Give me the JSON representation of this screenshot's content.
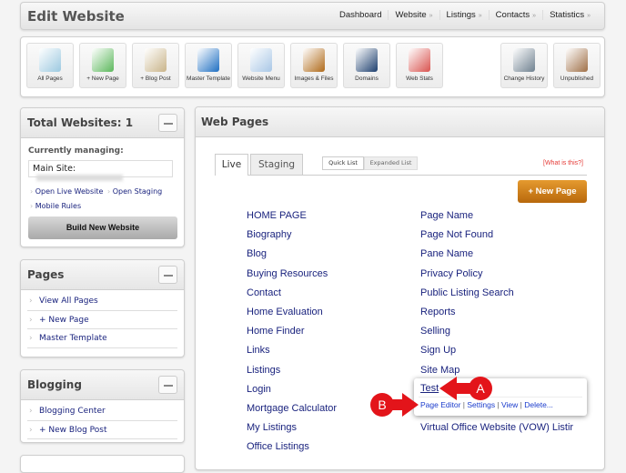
{
  "header": {
    "title": "Edit Website",
    "nav": [
      {
        "label": "Dashboard",
        "dropdown": false
      },
      {
        "label": "Website",
        "dropdown": true
      },
      {
        "label": "Listings",
        "dropdown": true
      },
      {
        "label": "Contacts",
        "dropdown": true
      },
      {
        "label": "Statistics",
        "dropdown": true
      }
    ]
  },
  "toolbar": [
    {
      "label": "All Pages",
      "icon": "pages-icon",
      "color": "#9cc9e0"
    },
    {
      "label": "+ New Page",
      "icon": "new-page-icon",
      "color": "#5cb85c"
    },
    {
      "label": "+ Blog Post",
      "icon": "book-pen-icon",
      "color": "#c9b48a"
    },
    {
      "label": "Master Template",
      "icon": "template-icon",
      "color": "#1f6fc2"
    },
    {
      "label": "Website Menu",
      "icon": "sitemap-icon",
      "color": "#a9c7e6"
    },
    {
      "label": "Images & Files",
      "icon": "file-cabinet-icon",
      "color": "#b06a1a"
    },
    {
      "label": "Domains",
      "icon": "domains-icon",
      "color": "#1d3f6e"
    },
    {
      "label": "Web Stats",
      "icon": "bar-chart-icon",
      "color": "#d9534f"
    },
    {
      "label": "Change History",
      "icon": "time-machine-icon",
      "color": "#6f8190"
    },
    {
      "label": "Unpublished",
      "icon": "easel-icon",
      "color": "#a07048"
    }
  ],
  "sidebar": {
    "websites": {
      "title": "Total Websites: 1",
      "managing_label": "Currently managing:",
      "site_label": "Main Site:",
      "links": [
        "Open Live Website",
        "Open Staging",
        "Mobile Rules"
      ],
      "build_button": "Build New Website"
    },
    "pages": {
      "title": "Pages",
      "items": [
        "View All Pages",
        "+ New Page",
        "Master Template"
      ]
    },
    "blogging": {
      "title": "Blogging",
      "items": [
        "Blogging Center",
        "+ New Blog Post"
      ]
    }
  },
  "main": {
    "title": "Web Pages",
    "tabs": [
      "Live",
      "Staging"
    ],
    "view_toggle": [
      "Quick List",
      "Expanded List"
    ],
    "help_link": "[What is this?]",
    "new_page_button": "+ New Page",
    "left_pages": [
      "HOME PAGE",
      "Biography",
      "Blog",
      "Buying Resources",
      "Contact",
      "Home Evaluation",
      "Home Finder",
      "Links",
      "Listings",
      "Login",
      "Mortgage Calculator",
      "My Listings",
      "Office Listings"
    ],
    "right_pages": [
      "Page Name",
      "Page Not Found",
      "Pane Name",
      "Privacy Policy",
      "Public Listing Search",
      "Reports",
      "Selling",
      "Sign Up",
      "Site Map"
    ],
    "popup": {
      "page": "Test",
      "actions": [
        "Page Editor",
        "Settings",
        "View",
        "Delete..."
      ]
    },
    "after_popup": "Virtual Office Website (VOW) Listir",
    "annotations": {
      "a": "A",
      "b": "B",
      "color": "#e3141a"
    }
  }
}
